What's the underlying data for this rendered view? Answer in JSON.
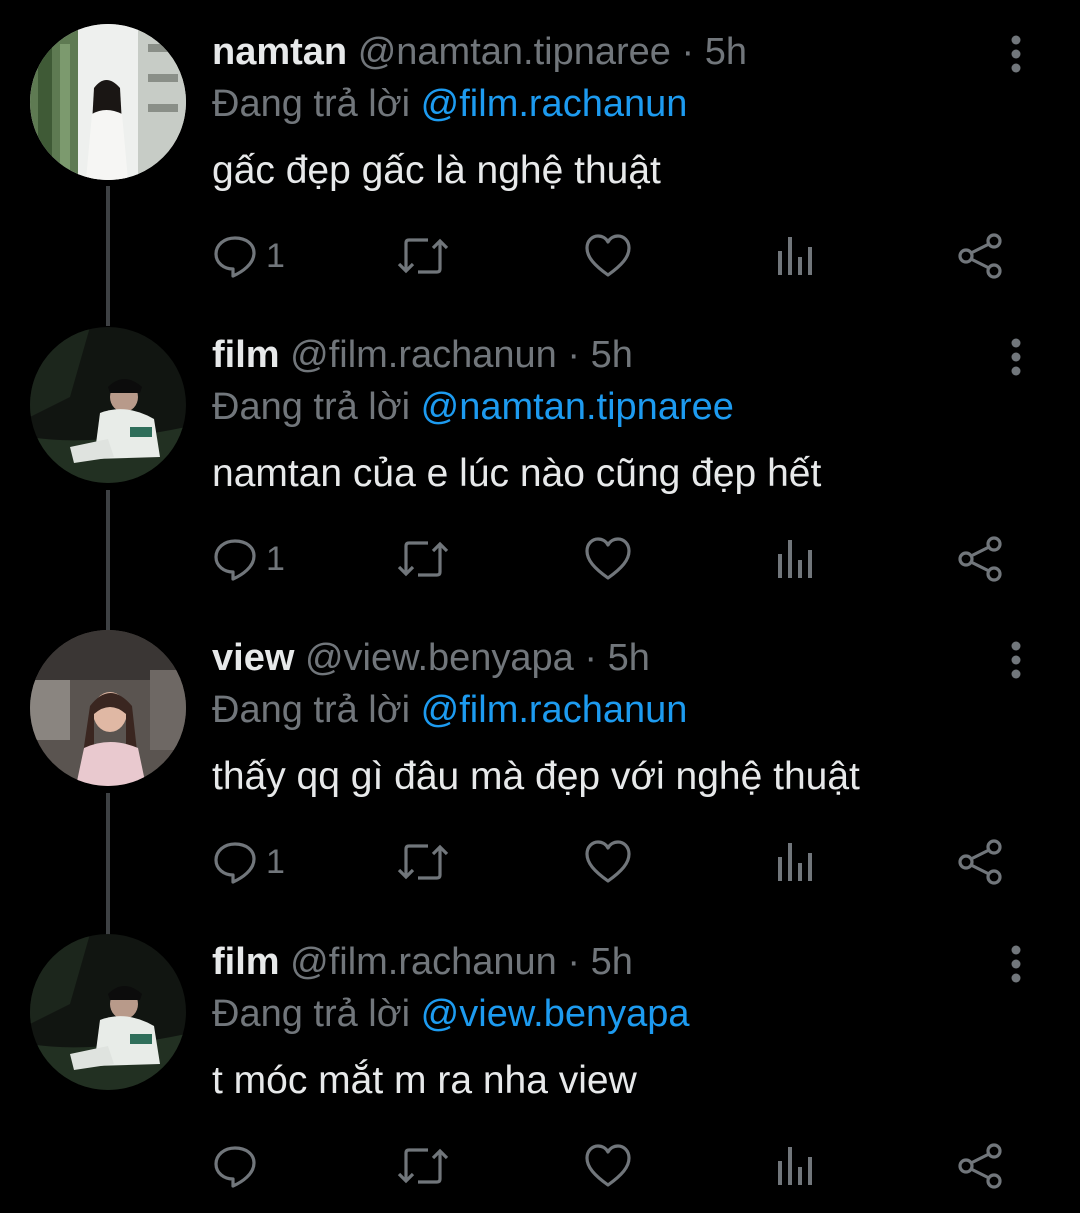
{
  "colors": {
    "background": "#000000",
    "text_primary": "#e7e9ea",
    "text_secondary": "#71767b",
    "mention": "#1d9bf0",
    "thread_line": "#3e4144"
  },
  "icons": {
    "reply": "speech-bubble-icon",
    "retweet": "retweet-icon",
    "like": "heart-icon",
    "views": "bar-chart-icon",
    "share": "share-icon",
    "more": "vertical-ellipsis-icon"
  },
  "tweets": [
    {
      "name": "namtan",
      "handle": "@namtan.tipnaree",
      "separator": "·",
      "time": "5h",
      "replying_prefix": "Đang trả lời",
      "replying_to": "@film.rachanun",
      "text": "gấc đẹp gấc là nghệ thuật",
      "reply_count": "1"
    },
    {
      "name": "film",
      "handle": "@film.rachanun",
      "separator": "·",
      "time": "5h",
      "replying_prefix": "Đang trả lời",
      "replying_to": "@namtan.tipnaree",
      "text": "namtan của e lúc nào cũng đẹp hết",
      "reply_count": "1"
    },
    {
      "name": "view",
      "handle": "@view.benyapa",
      "separator": "·",
      "time": "5h",
      "replying_prefix": "Đang trả lời",
      "replying_to": "@film.rachanun",
      "text": "thấy qq gì đâu mà đẹp với nghệ thuật",
      "reply_count": "1"
    },
    {
      "name": "film",
      "handle": "@film.rachanun",
      "separator": "·",
      "time": "5h",
      "replying_prefix": "Đang trả lời",
      "replying_to": "@view.benyapa",
      "text": "t móc mắt m ra nha view",
      "reply_count": ""
    }
  ]
}
